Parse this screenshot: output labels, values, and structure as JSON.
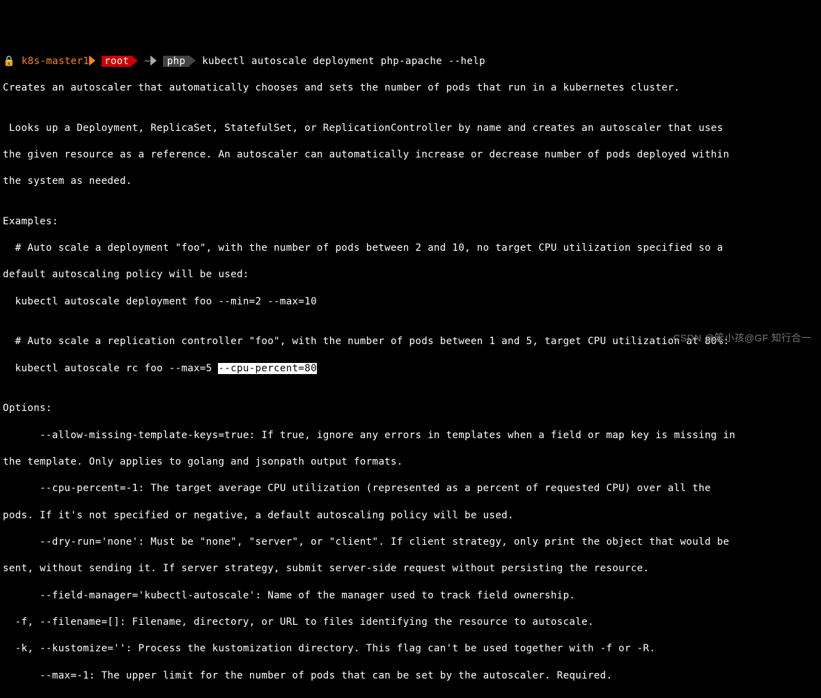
{
  "prompt": {
    "lock": "🔒",
    "host": "k8s-master1",
    "user": "root",
    "tilde": "~",
    "dir": "php",
    "command": "kubectl autoscale deployment php-apache --help"
  },
  "output": {
    "line1": "Creates an autoscaler that automatically chooses and sets the number of pods that run in a kubernetes cluster.",
    "line2": "",
    "line3": " Looks up a Deployment, ReplicaSet, StatefulSet, or ReplicationController by name and creates an autoscaler that uses",
    "line4": "the given resource as a reference. An autoscaler can automatically increase or decrease number of pods deployed within",
    "line5": "the system as needed.",
    "line6": "",
    "line7": "Examples:",
    "line8": "  # Auto scale a deployment \"foo\", with the number of pods between 2 and 10, no target CPU utilization specified so a",
    "line9": "default autoscaling policy will be used:",
    "line10": "  kubectl autoscale deployment foo --min=2 --max=10",
    "line11": "",
    "line12": "  # Auto scale a replication controller \"foo\", with the number of pods between 1 and 5, target CPU utilization at 80%:",
    "line13a": "  kubectl autoscale rc foo --max=5 ",
    "line13b": "--cpu-percent=80",
    "line14": "",
    "line15": "Options:",
    "line16": "      --allow-missing-template-keys=true: If true, ignore any errors in templates when a field or map key is missing in",
    "line17": "the template. Only applies to golang and jsonpath output formats.",
    "line18": "      --cpu-percent=-1: The target average CPU utilization (represented as a percent of requested CPU) over all the",
    "line19": "pods. If it's not specified or negative, a default autoscaling policy will be used.",
    "line20": "      --dry-run='none': Must be \"none\", \"server\", or \"client\". If client strategy, only print the object that would be",
    "line21": "sent, without sending it. If server strategy, submit server-side request without persisting the resource.",
    "line22": "      --field-manager='kubectl-autoscale': Name of the manager used to track field ownership.",
    "line23": "  -f, --filename=[]: Filename, directory, or URL to files identifying the resource to autoscale.",
    "line24": "  -k, --kustomize='': Process the kustomization directory. This flag can't be used together with -f or -R.",
    "line25": "      --max=-1: The upper limit for the number of pods that can be set by the autoscaler. Required."
  },
  "watermark": "CSDN @笨小孩@GF 知行合一"
}
